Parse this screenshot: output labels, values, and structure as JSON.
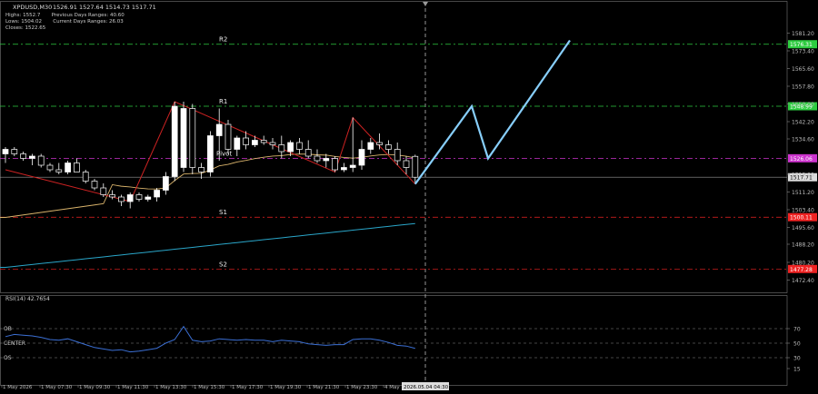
{
  "header": {
    "symbol": "XPDUSD,M30",
    "ohlc": "1526.91 1527.64 1514.73 1517.71",
    "line2": "Highs: 1552.7       Previous Days Ranges: 40.60",
    "line3": "Lows: 1504.02       Current Days Ranges: 26.03",
    "line4": "Closes: 1522.65"
  },
  "chart_data": [
    {
      "type": "candlestick",
      "title": "XPDUSD,M30",
      "y_range": [
        1467,
        1595
      ],
      "y_ticks": [
        1581.2,
        1573.4,
        1565.6,
        1557.8,
        1550.0,
        1542.2,
        1534.6,
        1519.0,
        1511.2,
        1503.4,
        1495.6,
        1488.2,
        1480.2,
        1472.4
      ],
      "x_labels": [
        "1 May 2026",
        "1 May 07:30",
        "1 May 09:30",
        "1 May 11:30",
        "1 May 13:30",
        "1 May 15:30",
        "1 May 17:30",
        "1 May 19:30",
        "1 May 21:30",
        "1 May 23:30",
        "4 May"
      ],
      "current_time_label": "2026.05.04 04:30",
      "candles": [
        {
          "o": 1528,
          "h": 1531,
          "l": 1524,
          "c": 1530
        },
        {
          "o": 1530,
          "h": 1531,
          "l": 1527,
          "c": 1528
        },
        {
          "o": 1528,
          "h": 1529,
          "l": 1525,
          "c": 1526
        },
        {
          "o": 1526,
          "h": 1528,
          "l": 1523,
          "c": 1527
        },
        {
          "o": 1527,
          "h": 1528,
          "l": 1522,
          "c": 1523
        },
        {
          "o": 1523,
          "h": 1524,
          "l": 1520,
          "c": 1521
        },
        {
          "o": 1521,
          "h": 1524,
          "l": 1519,
          "c": 1520
        },
        {
          "o": 1520,
          "h": 1525,
          "l": 1519,
          "c": 1524
        },
        {
          "o": 1524,
          "h": 1526,
          "l": 1520,
          "c": 1520
        },
        {
          "o": 1520,
          "h": 1521,
          "l": 1515,
          "c": 1516
        },
        {
          "o": 1516,
          "h": 1517,
          "l": 1512,
          "c": 1513
        },
        {
          "o": 1513,
          "h": 1515,
          "l": 1509,
          "c": 1510
        },
        {
          "o": 1510,
          "h": 1512,
          "l": 1508,
          "c": 1509
        },
        {
          "o": 1509,
          "h": 1510,
          "l": 1505,
          "c": 1507
        },
        {
          "o": 1507,
          "h": 1511,
          "l": 1504,
          "c": 1510
        },
        {
          "o": 1510,
          "h": 1511,
          "l": 1507,
          "c": 1508
        },
        {
          "o": 1508,
          "h": 1510,
          "l": 1507,
          "c": 1509
        },
        {
          "o": 1509,
          "h": 1513,
          "l": 1507,
          "c": 1512
        },
        {
          "o": 1512,
          "h": 1520,
          "l": 1510,
          "c": 1518
        },
        {
          "o": 1518,
          "h": 1551,
          "l": 1516,
          "c": 1549
        },
        {
          "o": 1522,
          "h": 1551,
          "l": 1520,
          "c": 1548
        },
        {
          "o": 1548,
          "h": 1550,
          "l": 1519,
          "c": 1522
        },
        {
          "o": 1522,
          "h": 1524,
          "l": 1517,
          "c": 1520
        },
        {
          "o": 1520,
          "h": 1538,
          "l": 1518,
          "c": 1536
        },
        {
          "o": 1536,
          "h": 1548,
          "l": 1525,
          "c": 1541
        },
        {
          "o": 1541,
          "h": 1543,
          "l": 1528,
          "c": 1530
        },
        {
          "o": 1530,
          "h": 1536,
          "l": 1527,
          "c": 1535
        },
        {
          "o": 1535,
          "h": 1538,
          "l": 1530,
          "c": 1532
        },
        {
          "o": 1532,
          "h": 1536,
          "l": 1531,
          "c": 1534
        },
        {
          "o": 1534,
          "h": 1536,
          "l": 1532,
          "c": 1533
        },
        {
          "o": 1533,
          "h": 1535,
          "l": 1530,
          "c": 1532
        },
        {
          "o": 1532,
          "h": 1536,
          "l": 1526,
          "c": 1529
        },
        {
          "o": 1529,
          "h": 1534,
          "l": 1527,
          "c": 1533
        },
        {
          "o": 1533,
          "h": 1535,
          "l": 1528,
          "c": 1530
        },
        {
          "o": 1530,
          "h": 1534,
          "l": 1526,
          "c": 1527
        },
        {
          "o": 1527,
          "h": 1530,
          "l": 1524,
          "c": 1525
        },
        {
          "o": 1525,
          "h": 1528,
          "l": 1522,
          "c": 1526
        },
        {
          "o": 1526,
          "h": 1527,
          "l": 1520,
          "c": 1521
        },
        {
          "o": 1521,
          "h": 1524,
          "l": 1520,
          "c": 1522
        },
        {
          "o": 1522,
          "h": 1544,
          "l": 1520,
          "c": 1523
        },
        {
          "o": 1523,
          "h": 1534,
          "l": 1521,
          "c": 1530
        },
        {
          "o": 1530,
          "h": 1535,
          "l": 1528,
          "c": 1533
        },
        {
          "o": 1533,
          "h": 1537,
          "l": 1530,
          "c": 1532
        },
        {
          "o": 1532,
          "h": 1534,
          "l": 1528,
          "c": 1530
        },
        {
          "o": 1530,
          "h": 1533,
          "l": 1523,
          "c": 1525
        },
        {
          "o": 1525,
          "h": 1527,
          "l": 1519,
          "c": 1522
        },
        {
          "o": 1526.91,
          "h": 1527.64,
          "l": 1514.73,
          "c": 1517.71
        }
      ],
      "zigzag": [
        1521,
        1507,
        1551,
        1532,
        1520,
        1544,
        1514.73
      ],
      "forecast_path": [
        1514.73,
        1549,
        1526,
        1578
      ],
      "levels": [
        {
          "name": "R2",
          "value": 1576.31,
          "label": "1576.31",
          "color": "#2ecc40"
        },
        {
          "name": "R1",
          "value": 1548.99,
          "label": "1548.99",
          "color": "#2ecc40"
        },
        {
          "name": "Pivot",
          "value": 1526.06,
          "label": "1526.06",
          "color": "#cc33cc"
        },
        {
          "name": "S1",
          "value": 1500.11,
          "label": "1500.11",
          "color": "#ee2222"
        },
        {
          "name": "S2",
          "value": 1477.28,
          "label": "1477.28",
          "color": "#ee2222"
        }
      ],
      "current_price": {
        "value": 1517.71,
        "label": "1517.71"
      },
      "colors": {
        "bull": "#ffffff",
        "bear": "#ffffff",
        "zigzag": "#cc2222",
        "forecast": "#87cefa",
        "ma_fast": "#d9b36b",
        "ma_slow": "#2aa6c9"
      }
    },
    {
      "type": "line",
      "title": "RSI(14) 42.7654",
      "y_range": [
        0,
        100
      ],
      "y_ticks": [
        70,
        50,
        30,
        15
      ],
      "levels": [
        {
          "name": "OB",
          "value": 70
        },
        {
          "name": "CENTER",
          "value": 50
        },
        {
          "name": "OS",
          "value": 30
        }
      ],
      "series": [
        {
          "name": "RSI(14)",
          "values": [
            59,
            62,
            61,
            60,
            58,
            55,
            54,
            56,
            52,
            48,
            44,
            42,
            40,
            41,
            38,
            39,
            41,
            43,
            50,
            55,
            73,
            54,
            52,
            53,
            56,
            55,
            54,
            55,
            54,
            54,
            52,
            54,
            53,
            52,
            49,
            48,
            47,
            48,
            48,
            55,
            56,
            56,
            54,
            51,
            47,
            46,
            42.77
          ]
        }
      ]
    }
  ]
}
